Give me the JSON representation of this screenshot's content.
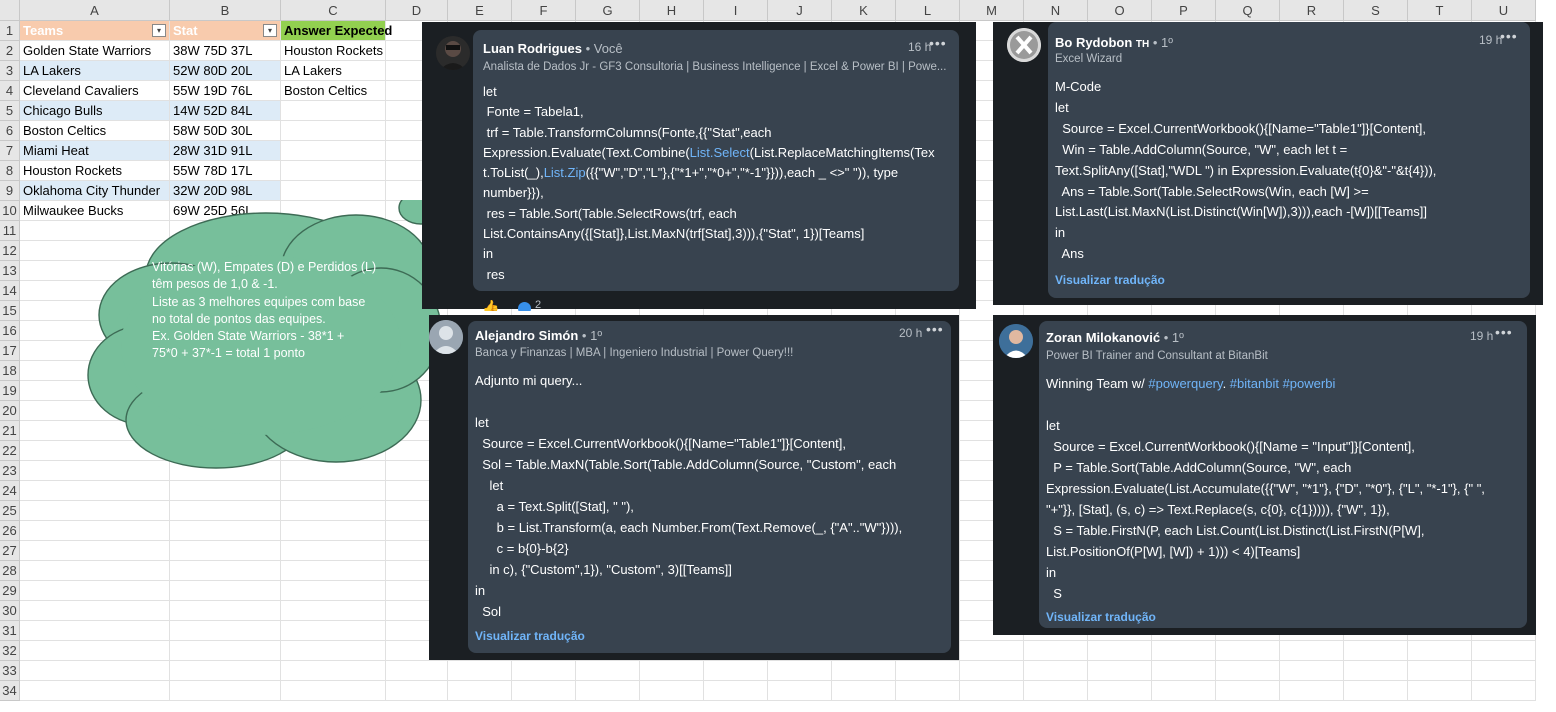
{
  "spreadsheet": {
    "columns": [
      "A",
      "B",
      "C",
      "D",
      "E",
      "F",
      "G",
      "H",
      "I",
      "J",
      "K",
      "L",
      "M",
      "N",
      "O",
      "P",
      "Q",
      "R",
      "S",
      "T",
      "U"
    ],
    "rows": [
      "1",
      "2",
      "3",
      "4",
      "5",
      "6",
      "7",
      "8",
      "9",
      "10",
      "11",
      "12",
      "13",
      "14",
      "15",
      "16",
      "17",
      "18",
      "19",
      "20",
      "21",
      "22",
      "23",
      "24",
      "25",
      "26",
      "27",
      "28",
      "29",
      "30",
      "31",
      "32",
      "33",
      "34"
    ],
    "headers": {
      "teams": "Teams",
      "stat": "Stat",
      "answer": "Answer Expected"
    },
    "teams": [
      {
        "team": "Golden State Warriors",
        "stat": "38W 75D 37L"
      },
      {
        "team": "LA Lakers",
        "stat": "52W 80D 20L"
      },
      {
        "team": "Cleveland Cavaliers",
        "stat": "55W 19D 76L"
      },
      {
        "team": "Chicago Bulls",
        "stat": "14W 52D 84L"
      },
      {
        "team": "Boston Celtics",
        "stat": "58W 50D 30L"
      },
      {
        "team": "Miami Heat",
        "stat": "28W 31D 91L"
      },
      {
        "team": "Houston Rockets",
        "stat": "55W 78D 17L"
      },
      {
        "team": "Oklahoma City Thunder",
        "stat": "32W 20D 98L"
      },
      {
        "team": "Milwaukee Bucks",
        "stat": "69W 25D 56L"
      }
    ],
    "answers": [
      "Houston Rockets",
      "LA Lakers",
      "Boston Celtics"
    ],
    "accent_colors": {
      "header_orange": "#f8cbad",
      "header_green": "#92d050",
      "band_blue": "#ddebf7",
      "cloud": "#77bf9b"
    }
  },
  "cloud": {
    "lines": [
      "Vitórias (W), Empates (D) e Perdidos (L)",
      "têm pesos de 1,0 & -1.",
      "Liste as 3 melhores equipes com base",
      "no total de pontos das equipes.",
      "Ex. Golden State Warriors - 38*1 +",
      "75*0 + 37*-1 = total 1 ponto"
    ]
  },
  "comments": [
    {
      "name": "Luan Rodrigues",
      "degree": "• Você",
      "subtitle": "Analista de Dados Jr - GF3 Consultoria | Business Intelligence | Excel & Power BI | Powe...",
      "time": "16 h",
      "more": "•••",
      "lines": [
        [
          {
            "t": "let"
          }
        ],
        [
          {
            "t": " Fonte = Tabela1,"
          }
        ],
        [
          {
            "t": " trf = Table.TransformColumns(Fonte,{{\"Stat\",each"
          }
        ],
        [
          {
            "t": "Expression.Evaluate(Text.Combine("
          },
          {
            "t": "List.Select",
            "link": true
          },
          {
            "t": "(List.ReplaceMatchingItems(Tex"
          }
        ],
        [
          {
            "t": "t.ToList(_),"
          },
          {
            "t": "List.Zip",
            "link": true
          },
          {
            "t": "({{\"W\",\"D\",\"L\"},{\"*1+\",\"*0+\",\"*-1\"}})),each _ <>\" \")), type"
          }
        ],
        [
          {
            "t": "number}}),"
          }
        ],
        [
          {
            "t": " res = Table.Sort(Table.SelectRows(trf, each"
          }
        ],
        [
          {
            "t": "List.ContainsAny({[Stat]},List.MaxN(trf[Stat],3))),{\"Stat\", 1})[Teams]"
          }
        ],
        [
          {
            "t": "in"
          }
        ],
        [
          {
            "t": " res"
          }
        ]
      ],
      "reactions": "2"
    },
    {
      "name": "Bo Rydobon",
      "badge": "TH",
      "degree": "• 1º",
      "subtitle": "Excel Wizard",
      "time": "19 h",
      "more": "•••",
      "lines": [
        [
          {
            "t": "M-Code"
          }
        ],
        [
          {
            "t": "let"
          }
        ],
        [
          {
            "t": "  Source = Excel.CurrentWorkbook(){[Name=\"Table1\"]}[Content],"
          }
        ],
        [
          {
            "t": "  Win = Table.AddColumn(Source, \"W\", each let t ="
          }
        ],
        [
          {
            "t": "Text.SplitAny([Stat],\"WDL \") in Expression.Evaluate(t{0}&\"-\"&t{4})),"
          }
        ],
        [
          {
            "t": "  Ans = Table.Sort(Table.SelectRows(Win, each [W] >="
          }
        ],
        [
          {
            "t": "List.Last(List.MaxN(List.Distinct(Win[W]),3))),each -[W])[[Teams]]"
          }
        ],
        [
          {
            "t": "in"
          }
        ],
        [
          {
            "t": "  Ans"
          }
        ]
      ],
      "translate": "Visualizar tradução"
    },
    {
      "name": "Alejandro Simón",
      "degree": "• 1º",
      "subtitle": "Banca y Finanzas | MBA | Ingeniero Industrial | Power Query!!!",
      "time": "20 h",
      "more": "•••",
      "lines": [
        [
          {
            "t": "Adjunto mi query..."
          }
        ],
        [
          {
            "t": ""
          }
        ],
        [
          {
            "t": "let"
          }
        ],
        [
          {
            "t": "  Source = Excel.CurrentWorkbook(){[Name=\"Table1\"]}[Content],"
          }
        ],
        [
          {
            "t": "  Sol = Table.MaxN(Table.Sort(Table.AddColumn(Source, \"Custom\", each"
          }
        ],
        [
          {
            "t": "    let"
          }
        ],
        [
          {
            "t": "      a = Text.Split([Stat], \" \"),"
          }
        ],
        [
          {
            "t": "      b = List.Transform(a, each Number.From(Text.Remove(_, {\"A\"..\"W\"}))),"
          }
        ],
        [
          {
            "t": "      c = b{0}-b{2}"
          }
        ],
        [
          {
            "t": "    in c), {\"Custom\",1}), \"Custom\", 3)[[Teams]]"
          }
        ],
        [
          {
            "t": "in"
          }
        ],
        [
          {
            "t": "  Sol"
          }
        ]
      ],
      "translate": "Visualizar tradução"
    },
    {
      "name": "Zoran Milokanović",
      "degree": "• 1º",
      "subtitle": "Power BI Trainer and Consultant at BitanBit",
      "time": "19 h",
      "more": "•••",
      "lines": [
        [
          {
            "t": "Winning Team w/ "
          },
          {
            "t": "#powerquery",
            "link": true
          },
          {
            "t": ". "
          },
          {
            "t": "#bitanbit",
            "link": true
          },
          {
            "t": " "
          },
          {
            "t": "#powerbi",
            "link": true
          }
        ],
        [
          {
            "t": ""
          }
        ],
        [
          {
            "t": "let"
          }
        ],
        [
          {
            "t": "  Source = Excel.CurrentWorkbook(){[Name = \"Input\"]}[Content],"
          }
        ],
        [
          {
            "t": "  P = Table.Sort(Table.AddColumn(Source, \"W\", each"
          }
        ],
        [
          {
            "t": "Expression.Evaluate(List.Accumulate({{\"W\", \"*1\"}, {\"D\", \"*0\"}, {\"L\", \"*-1\"}, {\" \","
          }
        ],
        [
          {
            "t": "\"+\"}}, [Stat], (s, c) => Text.Replace(s, c{0}, c{1})))), {\"W\", 1}),"
          }
        ],
        [
          {
            "t": "  S = Table.FirstN(P, each List.Count(List.Distinct(List.FirstN(P[W],"
          }
        ],
        [
          {
            "t": "List.PositionOf(P[W], [W]) + 1))) < 4)[Teams]"
          }
        ],
        [
          {
            "t": "in"
          }
        ],
        [
          {
            "t": "  S"
          }
        ]
      ],
      "translate": "Visualizar tradução"
    }
  ]
}
